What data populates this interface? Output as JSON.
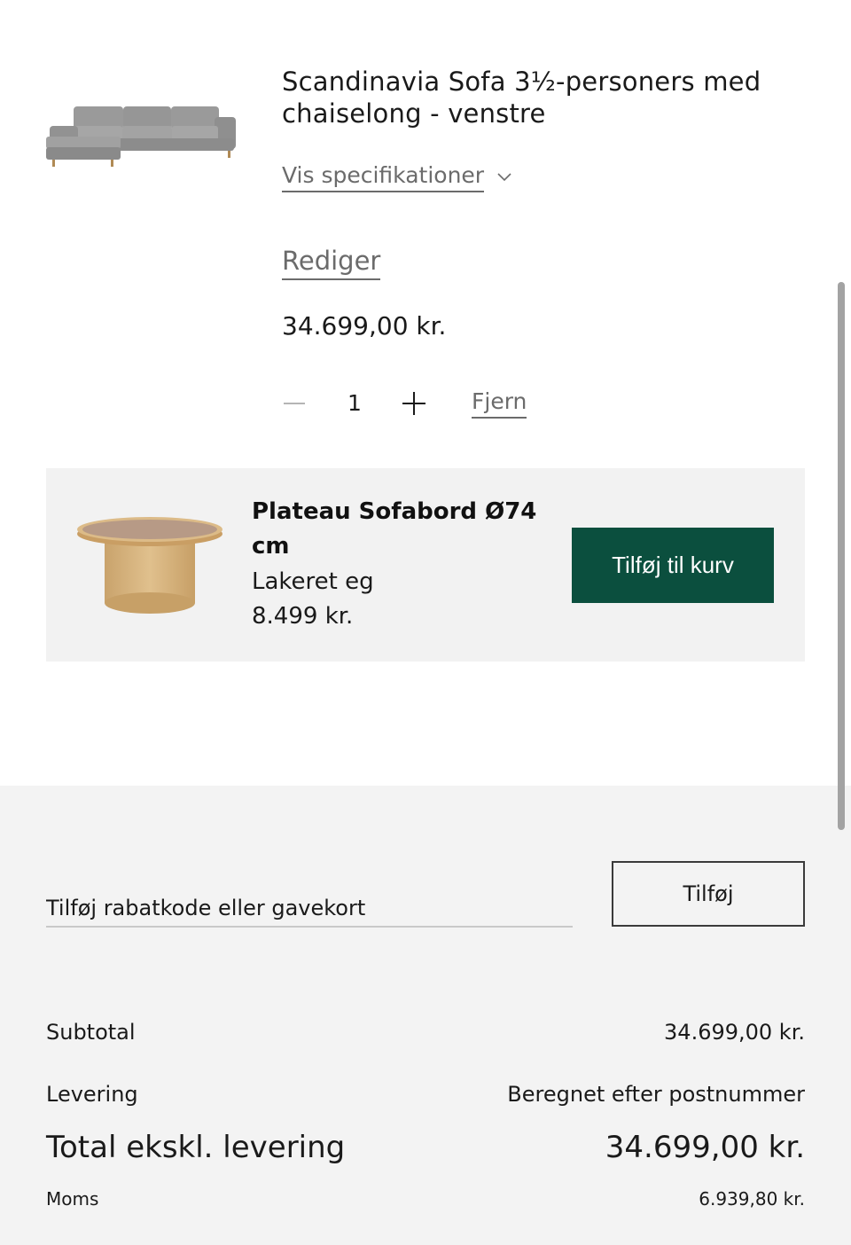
{
  "cart_item": {
    "title": "Scandinavia Sofa 3½-personers med chaiselong - venstre",
    "specs_label": "Vis specifikationer",
    "edit_label": "Rediger",
    "price": "34.699,00 kr.",
    "quantity": "1",
    "remove_label": "Fjern"
  },
  "upsell": {
    "name": "Plateau Sofabord Ø74 cm",
    "variant": "Lakeret eg",
    "price": "8.499 kr.",
    "add_label": "Tilføj til kurv"
  },
  "summary": {
    "discount_placeholder": "Tilføj rabatkode eller gavekort",
    "apply_label": "Tilføj",
    "subtotal_label": "Subtotal",
    "subtotal_value": "34.699,00 kr.",
    "delivery_label": "Levering",
    "delivery_value": "Beregnet efter postnummer",
    "total_label": "Total ekskl. levering",
    "total_value": "34.699,00 kr.",
    "vat_label": "Moms",
    "vat_value": "6.939,80 kr."
  },
  "colors": {
    "accent_button": "#0b4f3e",
    "upsell_background": "#f2f2f2",
    "summary_background": "#f3f3f3",
    "muted_text": "#6b6b6b"
  },
  "icons": {
    "specs_toggle": "chevron-down-icon",
    "qty_decrease": "minus-icon",
    "qty_increase": "plus-icon"
  }
}
